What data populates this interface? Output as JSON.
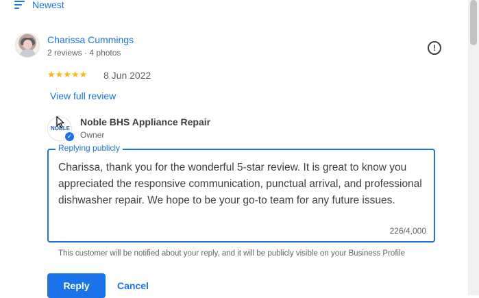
{
  "sort": {
    "label": "Newest",
    "icon": "sort-icon"
  },
  "review": {
    "reviewer_name": "Charissa Cummings",
    "reviewer_meta": "2 reviews · 4 photos",
    "stars": "★★★★★",
    "rating": 5,
    "date": "8 Jun 2022",
    "view_full_label": "View full review",
    "report_icon": "report-icon"
  },
  "owner": {
    "name": "Noble BHS Appliance Repair",
    "role": "Owner",
    "logo_text": "NOBLE",
    "verified_icon": "verified-check-icon"
  },
  "reply": {
    "legend": "Replying publicly",
    "text": "Charissa, thank you for the wonderful 5-star review. It is great to know you appreciated the responsive communication, punctual arrival, and professional dishwasher repair. We hope to be your go-to team for any future issues.",
    "char_count": "226/4,000",
    "notice": "This customer will be notified about your reply, and it will be publicly visible on your Business Profile",
    "reply_button": "Reply",
    "cancel_button": "Cancel"
  },
  "colors": {
    "accent": "#1a73e8",
    "star": "#fbbc04",
    "muted": "#5f6368"
  }
}
